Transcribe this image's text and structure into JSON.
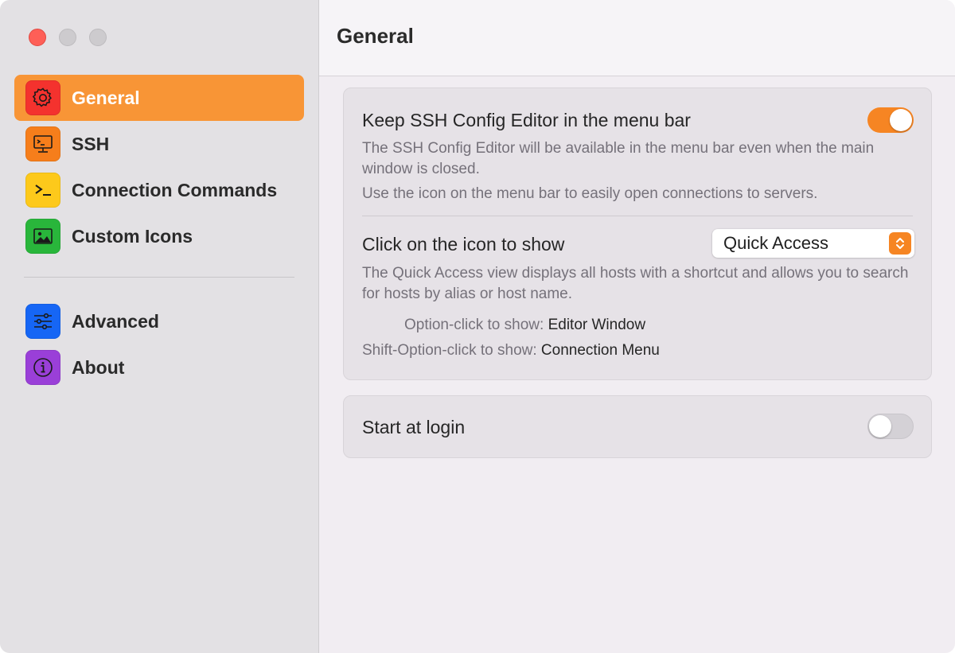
{
  "window": {
    "traffic_lights": [
      "close",
      "minimize",
      "zoom"
    ]
  },
  "sidebar": {
    "items": [
      {
        "label": "General",
        "icon": "gear-icon",
        "active": true,
        "color": "#f4322e"
      },
      {
        "label": "SSH",
        "icon": "terminal-screen-icon",
        "active": false,
        "color": "#f67e1b"
      },
      {
        "label": "Connection Commands",
        "icon": "prompt-icon",
        "active": false,
        "color": "#fdc91b"
      },
      {
        "label": "Custom Icons",
        "icon": "image-icon",
        "active": false,
        "color": "#29b63b"
      },
      {
        "label": "Advanced",
        "icon": "sliders-icon",
        "active": false,
        "color": "#1666f5"
      },
      {
        "label": "About",
        "icon": "info-icon",
        "active": false,
        "color": "#9a3fd8"
      }
    ],
    "active_color": "#f89536"
  },
  "header": {
    "title": "General"
  },
  "settings": {
    "menu_bar": {
      "title": "Keep SSH Config Editor in the menu bar",
      "enabled": true,
      "description_1": "The SSH Config Editor will be available in the menu bar even when the main window is closed.",
      "description_2": "Use the icon on the menu bar to easily open connections to servers."
    },
    "click_icon": {
      "title": "Click on the icon to show",
      "selected": "Quick Access",
      "description": "The Quick Access view displays all hosts with a shortcut and allows you to search for hosts by alias or host name.",
      "option_click_label": "Option-click to show:",
      "option_click_value": "Editor Window",
      "shift_option_click_label": "Shift-Option-click to show:",
      "shift_option_click_value": "Connection Menu"
    },
    "start_at_login": {
      "title": "Start at login",
      "enabled": false
    }
  },
  "accent_color": "#f68523"
}
